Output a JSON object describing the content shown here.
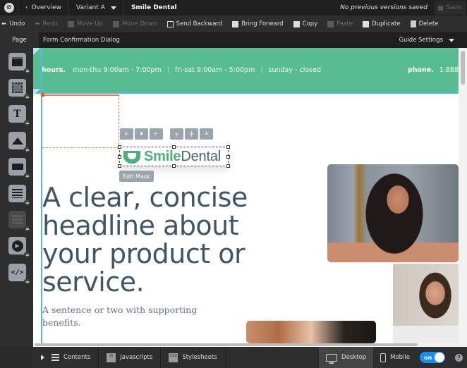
{
  "topbar": {
    "overview_label": "Overview",
    "variant_label": "Variant A",
    "page_title": "Smile Dental",
    "versions_status": "No previous versions saved",
    "save_label": "Save"
  },
  "toolbar": {
    "undo": "Undo",
    "redo": "Redo",
    "move_up": "Move Up",
    "move_down": "Move Down",
    "send_backward": "Send Backward",
    "bring_forward": "Bring Forward",
    "copy": "Copy",
    "paste": "Paste",
    "duplicate": "Duplicate",
    "delete": "Delete"
  },
  "tabrow": {
    "page_tab": "Page",
    "dialog_name": "Form Confirmation Dialog",
    "guide_settings": "Guide Settings"
  },
  "left_tools": [
    {
      "name": "section-tool",
      "icon": "section-icon"
    },
    {
      "name": "box-tool",
      "icon": "box-icon"
    },
    {
      "name": "text-tool",
      "icon": "text-icon",
      "glyph": "T"
    },
    {
      "name": "image-tool",
      "icon": "image-icon"
    },
    {
      "name": "button-tool",
      "icon": "button-icon"
    },
    {
      "name": "form-tool",
      "icon": "form-icon"
    },
    {
      "name": "social-tool",
      "icon": "social-icon",
      "disabled": true
    },
    {
      "name": "video-tool",
      "icon": "video-icon"
    },
    {
      "name": "code-tool",
      "icon": "code-icon",
      "glyph": "</>"
    }
  ],
  "canvas": {
    "hours_label": "hours.",
    "hours_weekday": "mon-thu 9:00am - 7:00pm",
    "hours_friday": "fri-sat 9:00am - 5:00pm",
    "hours_sunday": "sunday - closed",
    "separator": "|",
    "phone_label": "phone.",
    "phone_value": "1.888",
    "logo_smile": "Smile",
    "logo_dental": "Dental",
    "edit_mask": "Edit Mask",
    "headline": "A clear, concise headline about your product or service.",
    "subheadline": "A sentence or two with supporting benefits.",
    "brand_green": "#57bc8f",
    "selection_blue": "#5ab2ef",
    "guide_orange": "#f07c3c"
  },
  "bottombar": {
    "contents": "Contents",
    "javascripts": "Javascripts",
    "js_badge": "JS",
    "stylesheets": "Stylesheets",
    "css_badge": "CSS",
    "desktop": "Desktop",
    "mobile": "Mobile",
    "mobile_toggle": "on",
    "help": "?"
  }
}
